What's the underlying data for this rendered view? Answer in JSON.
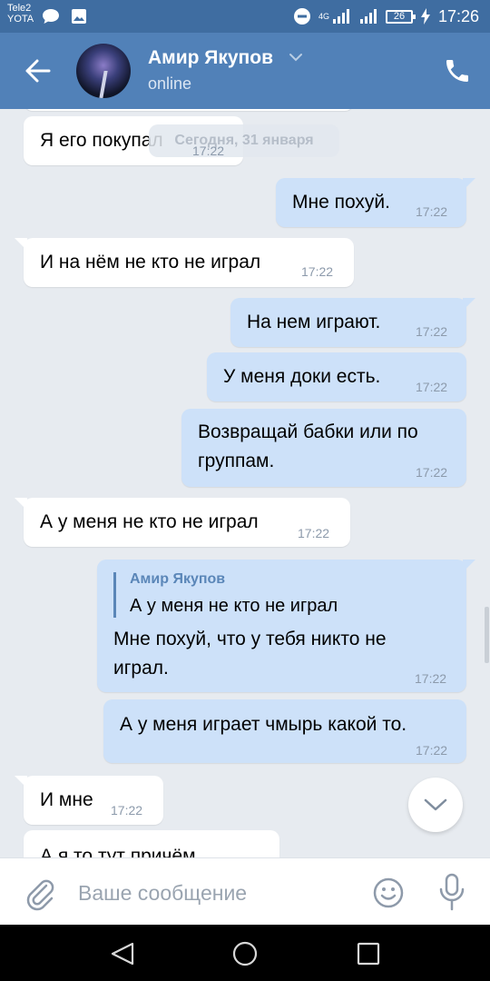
{
  "status_bar": {
    "carrier_1": "Tele2",
    "carrier_2": "YOTA",
    "network": "4G",
    "battery": "26",
    "time": "17:26"
  },
  "header": {
    "name": "Амир Якупов",
    "status": "online"
  },
  "date_chip": "Сегодня, 31 января",
  "messages": [
    {
      "dir": "in",
      "text": "Я его покупал",
      "time": "17:22"
    },
    {
      "dir": "out",
      "text": "Мне похуй.",
      "time": "17:22"
    },
    {
      "dir": "in",
      "text": "И на нём не кто не играл",
      "time": "17:22"
    },
    {
      "dir": "out",
      "text": "На нем играют.",
      "time": "17:22"
    },
    {
      "dir": "out",
      "text": "У меня доки есть.",
      "time": "17:22"
    },
    {
      "dir": "out",
      "text_line1": "Возвращай бабки или по",
      "text_line2": "группам.",
      "time": "17:22"
    },
    {
      "dir": "in",
      "text": "А у меня не кто не играл",
      "time": "17:22"
    },
    {
      "dir": "out",
      "reply_author": "Амир Якупов",
      "reply_text": "А у меня не кто не играл",
      "text_line1": "Мне похуй, что у тебя никто не",
      "text_line2": "играл.",
      "time": "17:22"
    },
    {
      "dir": "out",
      "text": "А у меня играет чмырь какой то.",
      "time": "17:22"
    },
    {
      "dir": "in",
      "text": "И мне",
      "time": "17:22"
    },
    {
      "dir": "in",
      "text": "А я то тут причём",
      "time": ""
    }
  ],
  "input": {
    "placeholder": "Ваше сообщение"
  },
  "colors": {
    "header": "#5181b8",
    "status_bar": "#3f6da1",
    "outgoing_bubble": "#cde1f9",
    "incoming_bubble": "#ffffff",
    "chat_background": "#e7ebf0"
  },
  "icons": [
    "back-arrow-icon",
    "chevron-down-icon",
    "phone-icon",
    "paperclip-icon",
    "smiley-icon",
    "microphone-icon",
    "scroll-down-icon"
  ]
}
